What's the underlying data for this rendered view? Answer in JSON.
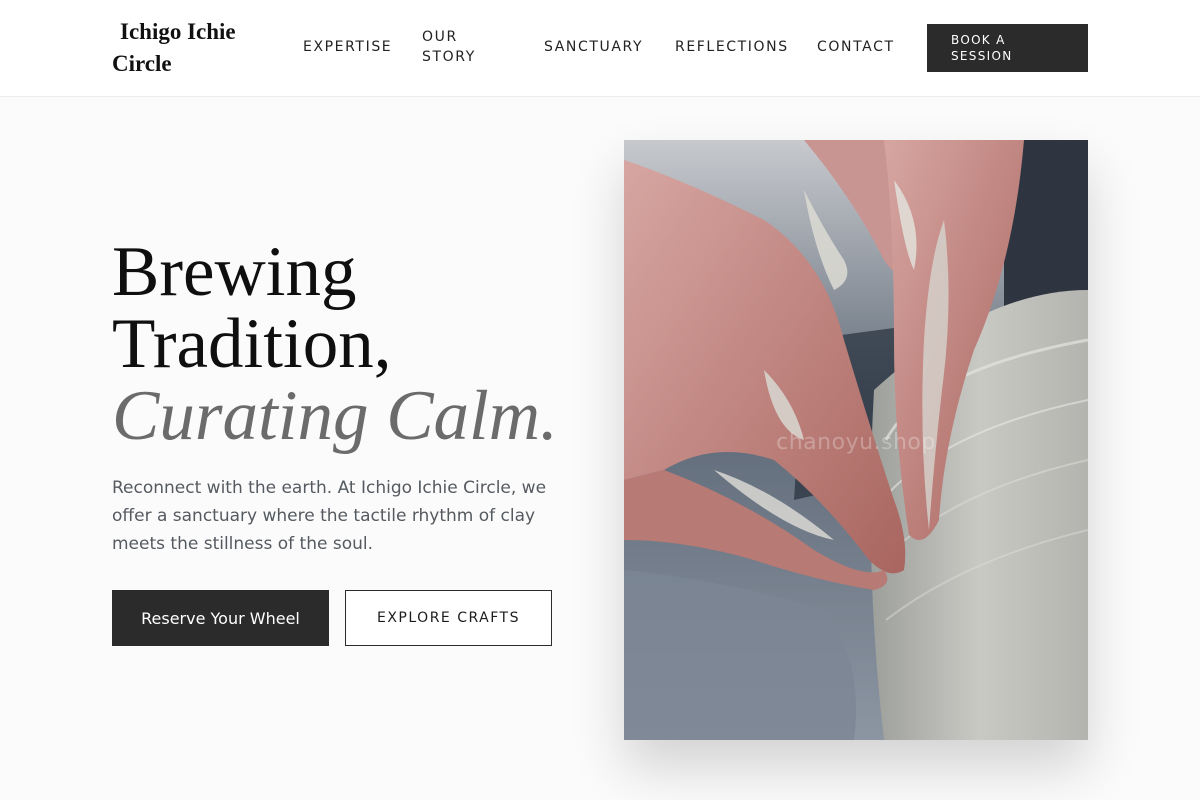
{
  "brand": {
    "name": "Ichigo Ichie Circle"
  },
  "nav": {
    "items": [
      {
        "label": "EXPERTISE"
      },
      {
        "label": "OUR STORY"
      },
      {
        "label": "SANCTUARY"
      },
      {
        "label": "REFLECTIONS"
      },
      {
        "label": "CONTACT"
      }
    ],
    "cta_label": "BOOK A SESSION"
  },
  "hero": {
    "title_line1": "Brewing",
    "title_line2": "Tradition,",
    "title_accent": "Curating Calm.",
    "description": "Reconnect with the earth. At Ichigo Ichie Circle, we offer a sanctuary where the tactile rhythm of clay meets the stillness of the soul.",
    "primary_button": "Reserve Your Wheel",
    "secondary_button": "EXPLORE CRAFTS",
    "image_watermark": "chanoyu.shop"
  },
  "colors": {
    "background": "#fbfbfb",
    "dark_button": "#2b2b2b",
    "accent_text": "#6b6b6b",
    "body_text": "#555a60"
  }
}
